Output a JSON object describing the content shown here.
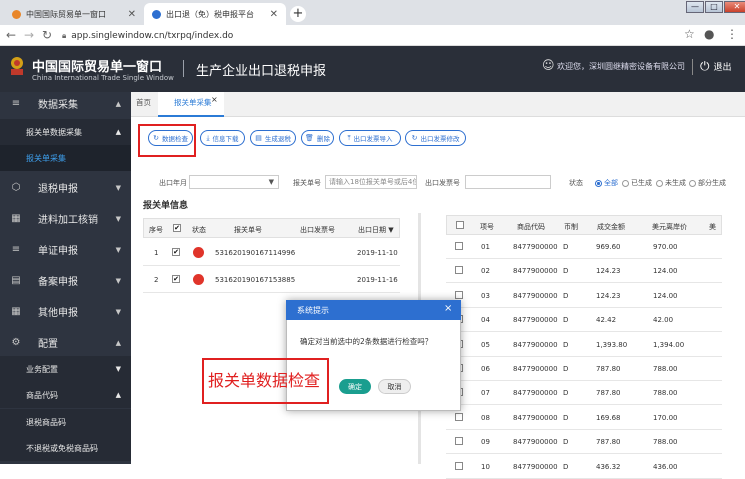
{
  "browser": {
    "tabs": [
      {
        "label": "中国国际贸易单一窗口",
        "active": false,
        "favicon_color": "#e8862a"
      },
      {
        "label": "出口退（免）税申报平台",
        "active": true,
        "favicon_color": "#2d6fd0"
      }
    ],
    "new_tab": "+",
    "url": "app.singlewindow.cn/txrpq/index.do",
    "window_controls": [
      "—",
      "□",
      "✕"
    ]
  },
  "header": {
    "logo_cn": "中国国际贸易单一窗口",
    "logo_en": "China International Trade Single Window",
    "title": "生产企业出口退税申报",
    "user_text": "欢迎您，深圳圆继精密设备有限公司",
    "logout": "退出"
  },
  "sidebar": {
    "items": [
      {
        "label": "数据采集",
        "icon": "layers-icon",
        "arrow": "▲"
      },
      {
        "label": "退税申报",
        "icon": "cube-icon",
        "arrow": "▼"
      },
      {
        "label": "进料加工核销",
        "icon": "grid-icon",
        "arrow": "▼"
      },
      {
        "label": "单证申报",
        "icon": "layers-icon",
        "arrow": "▼"
      },
      {
        "label": "备案申报",
        "icon": "book-icon",
        "arrow": "▼"
      },
      {
        "label": "其他申报",
        "icon": "grid-icon",
        "arrow": "▼"
      },
      {
        "label": "配置",
        "icon": "gear-icon",
        "arrow": "▲"
      }
    ],
    "subitems": [
      {
        "label": "报关单数据采集",
        "arrow": "▲"
      },
      {
        "label": "报关单采集",
        "arrow": ""
      },
      {
        "label": "业务配置",
        "arrow": "▼"
      },
      {
        "label": "商品代码",
        "arrow": "▲"
      },
      {
        "label": "退税商品码",
        "arrow": ""
      },
      {
        "label": "不退税或免税商品码",
        "arrow": ""
      }
    ]
  },
  "content_tabs": {
    "home": "首页",
    "current": "报关单采集",
    "current_close": "×"
  },
  "toolbar": {
    "buttons": [
      {
        "label": "数据检查",
        "icon": "refresh-icon"
      },
      {
        "label": "信息下载",
        "icon": "download-icon"
      },
      {
        "label": "生成退税",
        "icon": "doc-icon"
      },
      {
        "label": "删除",
        "icon": "trash-icon"
      },
      {
        "label": "出口发票导入",
        "icon": "upload-icon"
      },
      {
        "label": "出口发票修改",
        "icon": "refresh-icon"
      }
    ]
  },
  "search": {
    "month_label": "出口年月",
    "decl_label": "报关单号",
    "decl_placeholder": "请输入18位报关单号或后4位",
    "invoice_label": "出口发票号",
    "status_label": "状态",
    "status_options": [
      {
        "label": "全部",
        "selected": true
      },
      {
        "label": "已生成",
        "selected": false
      },
      {
        "label": "未生成",
        "selected": false
      },
      {
        "label": "部分生成",
        "selected": false
      }
    ]
  },
  "left_table": {
    "title": "报关单信息",
    "headers": [
      "序号",
      "状态",
      "报关单号",
      "出口发票号",
      "出口日期 ▼"
    ],
    "rows": [
      {
        "no": "1",
        "decl": "531620190167114996",
        "invoice": "",
        "date": "2019-11-10"
      },
      {
        "no": "2",
        "decl": "531620190167153885",
        "invoice": "",
        "date": "2019-11-16"
      }
    ]
  },
  "right_table": {
    "headers": [
      "项号",
      "商品代码",
      "币制",
      "成交金额",
      "美元离岸价",
      "美"
    ],
    "rows": [
      {
        "no": "01",
        "code": "8477900000",
        "cur": "D",
        "amount": "969.60",
        "fob": "970.00"
      },
      {
        "no": "02",
        "code": "8477900000",
        "cur": "D",
        "amount": "124.23",
        "fob": "124.00"
      },
      {
        "no": "03",
        "code": "8477900000",
        "cur": "D",
        "amount": "124.23",
        "fob": "124.00"
      },
      {
        "no": "04",
        "code": "8477900000",
        "cur": "D",
        "amount": "42.42",
        "fob": "42.00"
      },
      {
        "no": "05",
        "code": "8477900000",
        "cur": "D",
        "amount": "1,393.80",
        "fob": "1,394.00"
      },
      {
        "no": "06",
        "code": "8477900000",
        "cur": "D",
        "amount": "787.80",
        "fob": "788.00"
      },
      {
        "no": "07",
        "code": "8477900000",
        "cur": "D",
        "amount": "787.80",
        "fob": "788.00"
      },
      {
        "no": "08",
        "code": "8477900000",
        "cur": "D",
        "amount": "169.68",
        "fob": "170.00"
      },
      {
        "no": "09",
        "code": "8477900000",
        "cur": "D",
        "amount": "787.80",
        "fob": "788.00"
      },
      {
        "no": "10",
        "code": "8477900000",
        "cur": "D",
        "amount": "436.32",
        "fob": "436.00"
      }
    ]
  },
  "modal": {
    "title": "系统提示",
    "close": "×",
    "message": "确定对当前选中的2条数据进行检查吗？",
    "ok": "确定",
    "cancel": "取消"
  },
  "annotation": {
    "text": "报关单数据检查",
    "color": "#e02020"
  }
}
